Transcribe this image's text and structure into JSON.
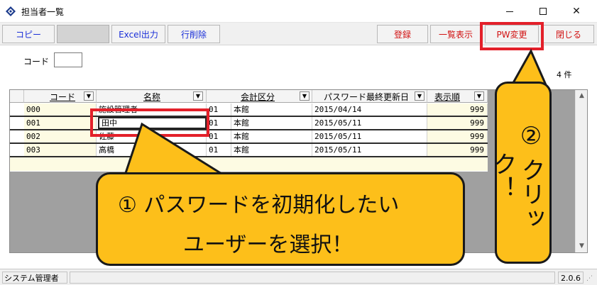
{
  "window": {
    "title": "担当者一覧",
    "minimize_icon": "minimize-icon",
    "maximize_icon": "maximize-icon",
    "close_icon": "close-icon"
  },
  "toolbar": {
    "copy": "コピー",
    "excel": "Excel出力",
    "delete_row": "行削除",
    "register": "登録",
    "list_view": "一覧表示",
    "pw_change": "PW変更",
    "close": "閉じる"
  },
  "form": {
    "code_label": "コード",
    "code_value": ""
  },
  "count_label": "4 件",
  "grid": {
    "columns": [
      "コード",
      "名称",
      "会計区分",
      "パスワード最終更新日",
      "表示順"
    ],
    "rows": [
      {
        "code": "000",
        "name": "施設管理者",
        "kbn_code": "01",
        "kbn_name": "本館",
        "date": "2015/04/14",
        "order": "999"
      },
      {
        "code": "001",
        "name": "田中",
        "kbn_code": "01",
        "kbn_name": "本館",
        "date": "2015/05/11",
        "order": "999"
      },
      {
        "code": "002",
        "name": "佐藤",
        "kbn_code": "01",
        "kbn_name": "本館",
        "date": "2015/05/11",
        "order": "999"
      },
      {
        "code": "003",
        "name": "高橋",
        "kbn_code": "01",
        "kbn_name": "本館",
        "date": "2015/05/11",
        "order": "999"
      }
    ]
  },
  "status": {
    "user": "システム管理者",
    "version": "2.0.6"
  },
  "annotations": {
    "step1_line1": "① パスワードを初期化したい",
    "step1_line2": "ユーザーを選択！",
    "step2": "② クリック！",
    "colors": {
      "highlight": "#e3202a",
      "callout": "#fdbf1a"
    }
  }
}
